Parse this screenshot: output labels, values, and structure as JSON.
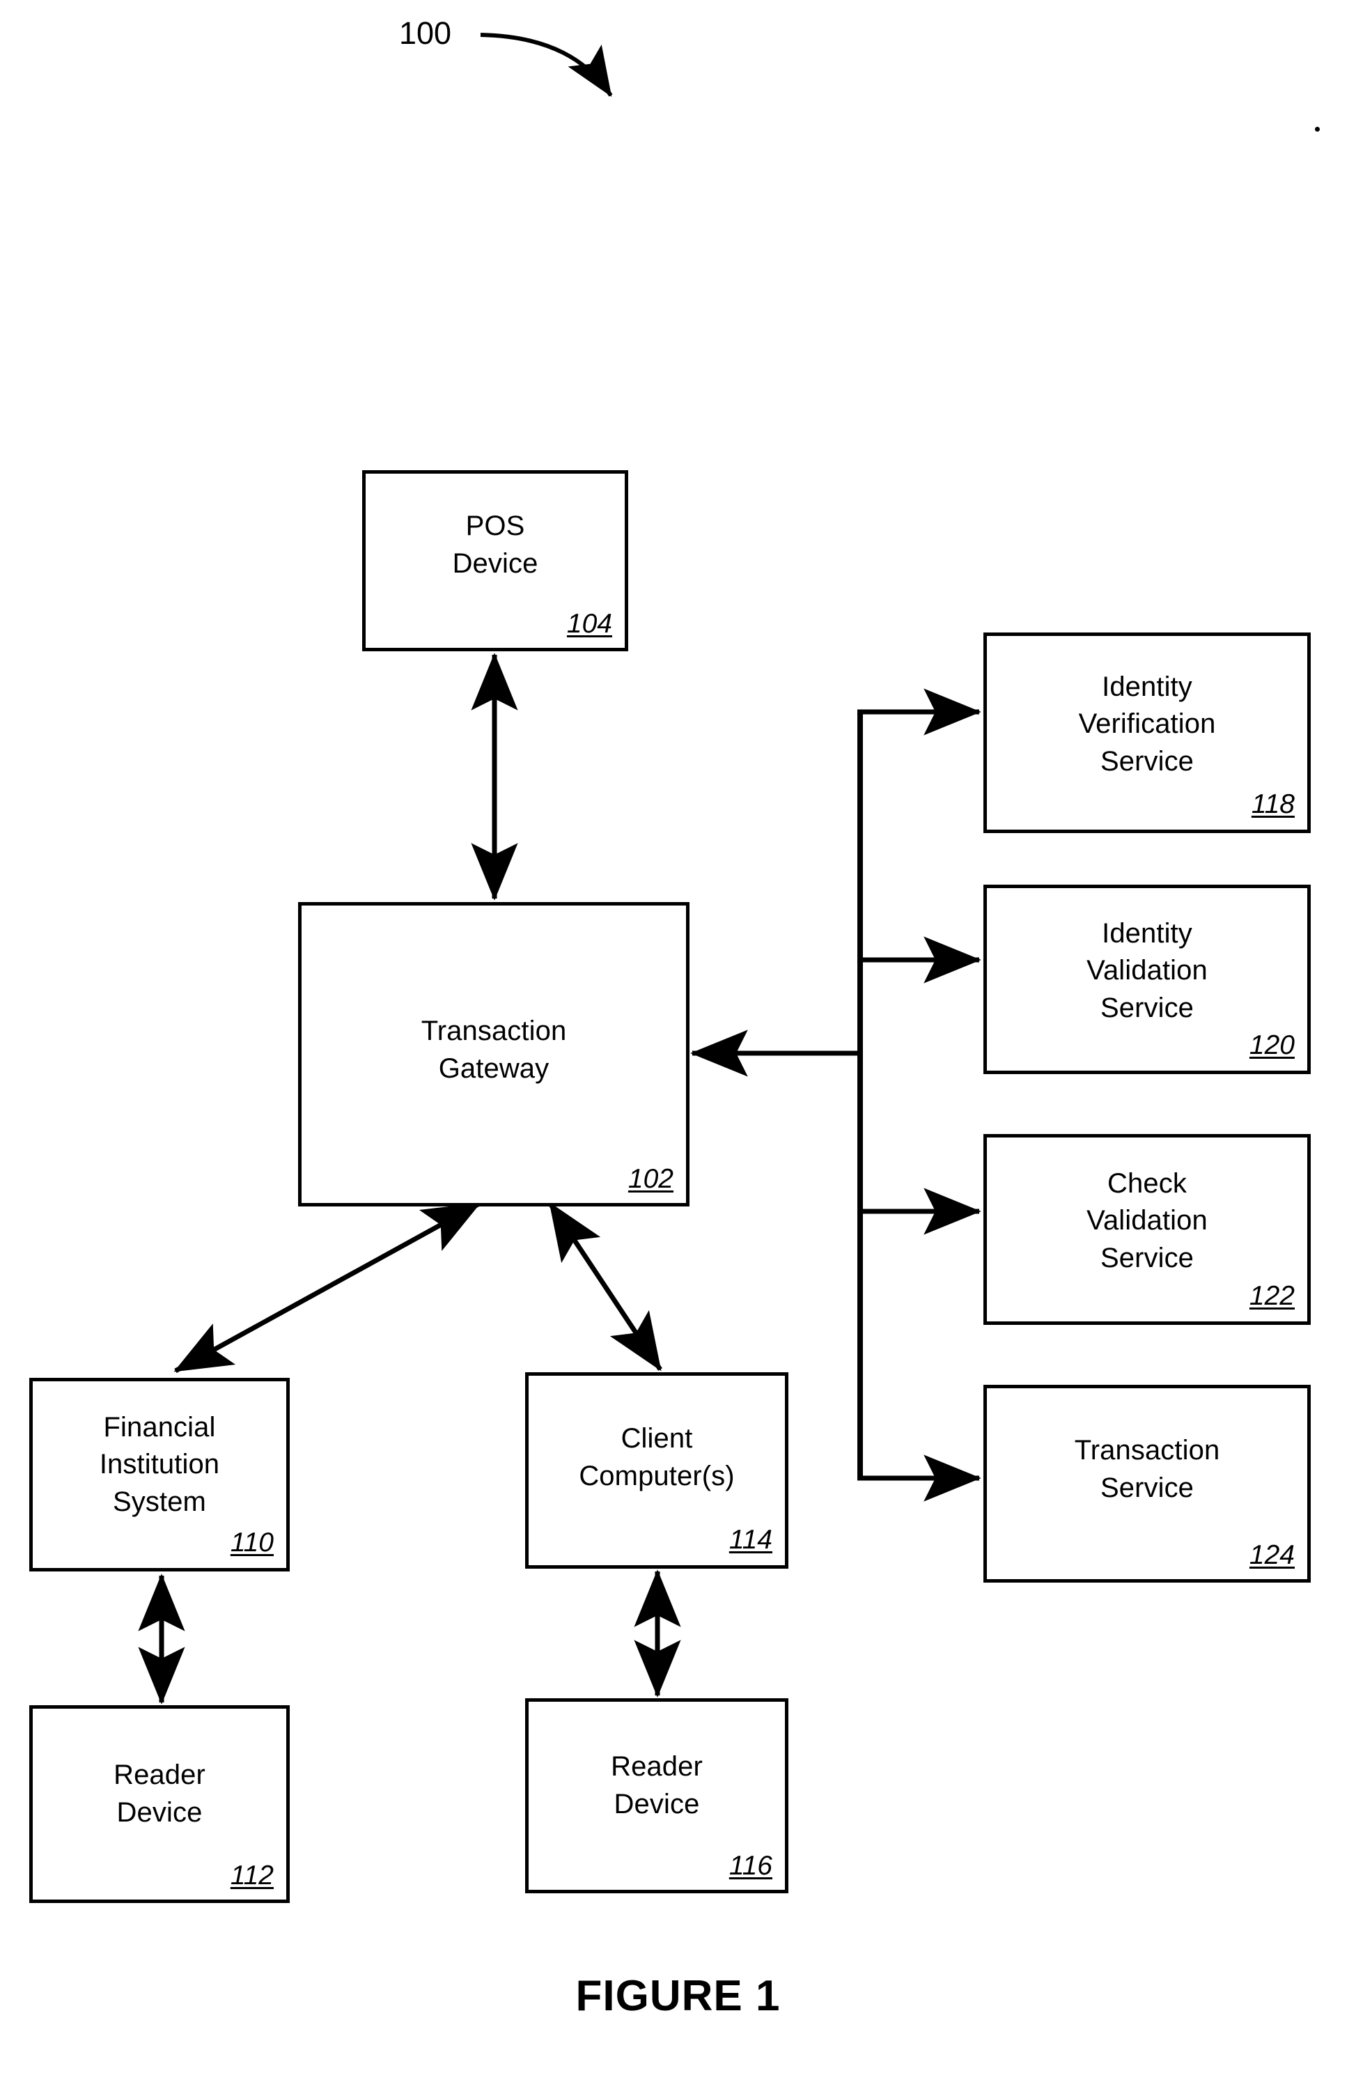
{
  "figure": {
    "caption": "FIGURE 1",
    "system_reference": "100"
  },
  "nodes": {
    "pos_device": {
      "label": "POS\nDevice",
      "ref": "104"
    },
    "transaction_gateway": {
      "label": "Transaction\nGateway",
      "ref": "102"
    },
    "identity_verification": {
      "label": "Identity\nVerification\nService",
      "ref": "118"
    },
    "identity_validation": {
      "label": "Identity\nValidation\nService",
      "ref": "120"
    },
    "check_validation": {
      "label": "Check\nValidation\nService",
      "ref": "122"
    },
    "transaction_service": {
      "label": "Transaction\nService",
      "ref": "124"
    },
    "financial_institution": {
      "label": "Financial\nInstitution\nSystem",
      "ref": "110"
    },
    "client_computers": {
      "label": "Client\nComputer(s)",
      "ref": "114"
    },
    "reader_device_left": {
      "label": "Reader\nDevice",
      "ref": "112"
    },
    "reader_device_right": {
      "label": "Reader\nDevice",
      "ref": "116"
    }
  },
  "connections": [
    {
      "from": "pos_device",
      "to": "transaction_gateway",
      "arrow": "double"
    },
    {
      "from": "transaction_gateway",
      "to": "financial_institution",
      "arrow": "double"
    },
    {
      "from": "transaction_gateway",
      "to": "client_computers",
      "arrow": "double"
    },
    {
      "from": "financial_institution",
      "to": "reader_device_left",
      "arrow": "double"
    },
    {
      "from": "client_computers",
      "to": "reader_device_right",
      "arrow": "double"
    },
    {
      "from": "service_bus",
      "to": "transaction_gateway",
      "arrow": "single"
    },
    {
      "from": "service_bus",
      "to": "identity_verification",
      "arrow": "single"
    },
    {
      "from": "service_bus",
      "to": "identity_validation",
      "arrow": "single"
    },
    {
      "from": "service_bus",
      "to": "check_validation",
      "arrow": "single"
    },
    {
      "from": "service_bus",
      "to": "transaction_service",
      "arrow": "single"
    }
  ],
  "style": {
    "ink": "#000000",
    "paper": "#ffffff"
  }
}
